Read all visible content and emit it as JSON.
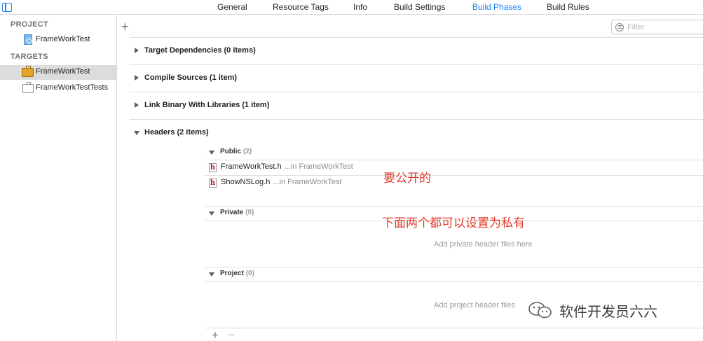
{
  "tabs": [
    {
      "label": "General",
      "active": false
    },
    {
      "label": "Resource Tags",
      "active": false
    },
    {
      "label": "Info",
      "active": false
    },
    {
      "label": "Build Settings",
      "active": false
    },
    {
      "label": "Build Phases",
      "active": true
    },
    {
      "label": "Build Rules",
      "active": false
    }
  ],
  "sidebar": {
    "project_header": "PROJECT",
    "project_item": "FrameWorkTest",
    "targets_header": "TARGETS",
    "targets": [
      {
        "label": "FrameWorkTest",
        "icon": "framework-icon",
        "selected": true
      },
      {
        "label": "FrameWorkTestTests",
        "icon": "test-bundle-icon",
        "selected": false
      }
    ]
  },
  "filter": {
    "placeholder": "Filter",
    "value": ""
  },
  "phases": [
    {
      "label": "Target Dependencies (0 items)",
      "expanded": false
    },
    {
      "label": "Compile Sources (1 item)",
      "expanded": false
    },
    {
      "label": "Link Binary With Libraries (1 item)",
      "expanded": false
    },
    {
      "label": "Headers (2 items)",
      "expanded": true
    }
  ],
  "headers": {
    "public": {
      "label": "Public",
      "count": "(2)",
      "files": [
        {
          "name": "FrameWorkTest.h",
          "location": "...in FrameWorkTest"
        },
        {
          "name": "ShowNSLog.h",
          "location": "...in FrameWorkTest"
        }
      ]
    },
    "private": {
      "label": "Private",
      "count": "(0)",
      "placeholder": "Add private header files here"
    },
    "project": {
      "label": "Project",
      "count": "(0)",
      "placeholder": "Add project header files"
    }
  },
  "annotations": {
    "public_note": "要公开的",
    "private_note": "下面两个都可以设置为私有"
  },
  "footer": {
    "add_symbol": "+",
    "remove_symbol": "−"
  },
  "watermark": {
    "text": "软件开发员六六"
  },
  "colors": {
    "accent": "#1a82fb",
    "annotation": "#e23a2a"
  }
}
